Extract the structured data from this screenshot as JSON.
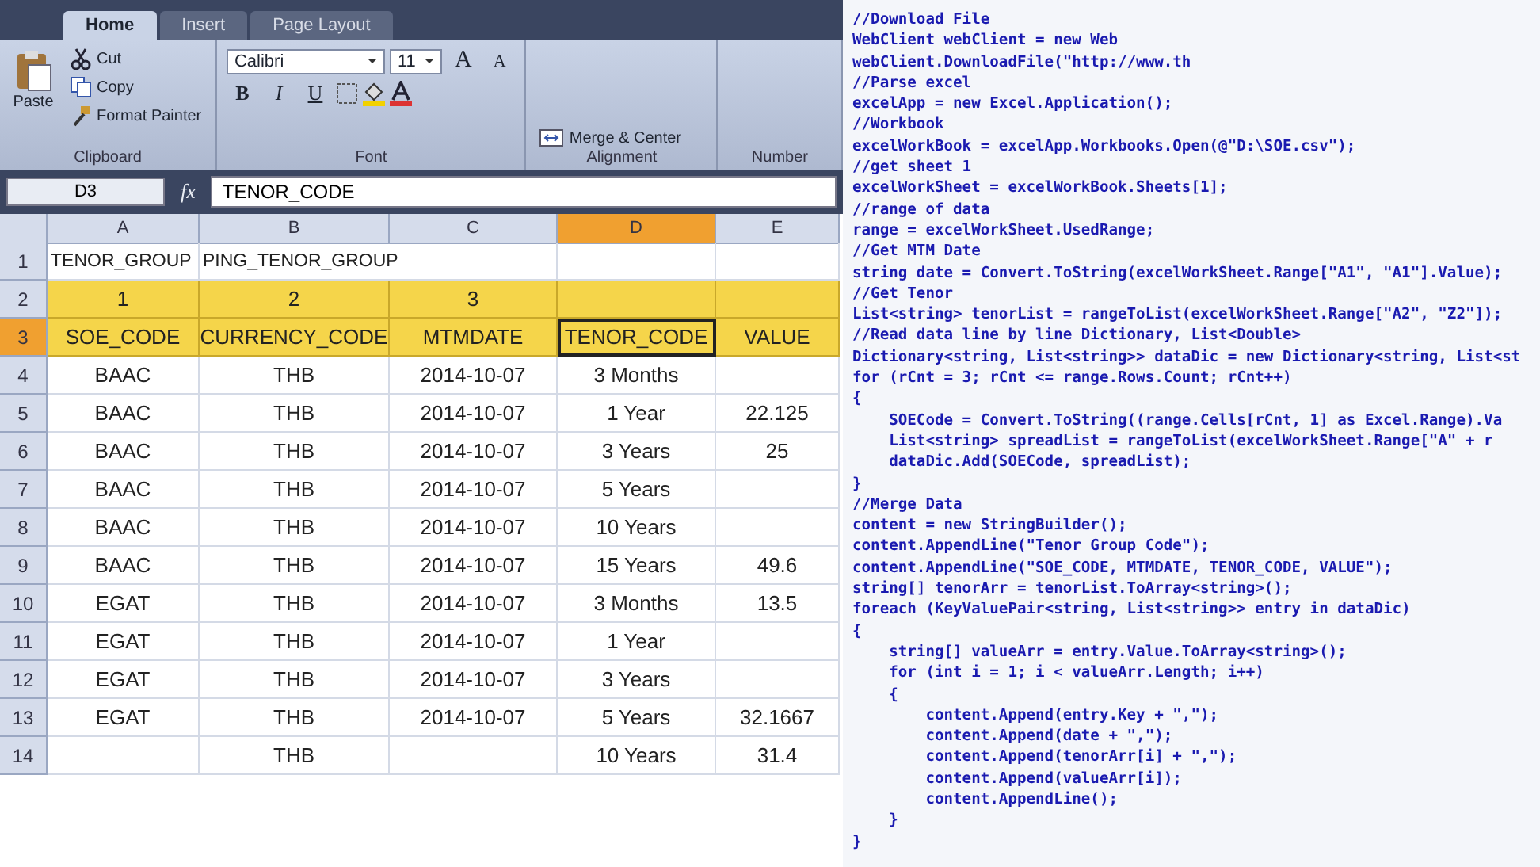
{
  "ribbon": {
    "tabs": [
      {
        "label": "Home",
        "selected": true
      },
      {
        "label": "Insert",
        "selected": false
      },
      {
        "label": "Page Layout",
        "selected": false
      }
    ],
    "clipboard": {
      "paste": "Paste",
      "cut": "Cut",
      "copy": "Copy",
      "format_painter": "Format Painter",
      "label": "Clipboard"
    },
    "font": {
      "name": "Calibri",
      "size": "11",
      "grow": "A",
      "shrink": "A",
      "bold": "B",
      "italic": "I",
      "underline": "U",
      "label": "Font"
    },
    "alignment": {
      "merge": "Merge & Center",
      "label": "Alignment"
    },
    "number": {
      "label": "Number"
    }
  },
  "formula_bar": {
    "name_box": "D3",
    "fx": "fx",
    "value": "TENOR_CODE"
  },
  "sheet": {
    "columns": [
      {
        "label": "A",
        "selected": false
      },
      {
        "label": "B",
        "selected": false
      },
      {
        "label": "C",
        "selected": false
      },
      {
        "label": "D",
        "selected": true
      },
      {
        "label": "E",
        "selected": false
      }
    ],
    "rows": [
      {
        "number": "1",
        "kind": "title",
        "selected": false,
        "cells": [
          "TENOR_GROUP",
          "PING_TENOR_GROUP"
        ]
      },
      {
        "number": "2",
        "kind": "header",
        "selected": false,
        "cells": [
          "1",
          "2",
          "3"
        ]
      },
      {
        "number": "3",
        "kind": "header",
        "selected": true,
        "cells": [
          "SOE_CODE",
          "CURRENCY_CODE",
          "MTMDATE",
          "TENOR_CODE",
          "VALUE"
        ]
      },
      {
        "number": "4",
        "kind": "data",
        "selected": false,
        "cells": [
          "BAAC",
          "THB",
          "2014-10-07",
          "3 Months"
        ]
      },
      {
        "number": "5",
        "kind": "data",
        "selected": false,
        "cells": [
          "BAAC",
          "THB",
          "2014-10-07",
          "1 Year",
          "22.125"
        ]
      },
      {
        "number": "6",
        "kind": "data",
        "selected": false,
        "cells": [
          "BAAC",
          "THB",
          "2014-10-07",
          "3 Years",
          "25"
        ]
      },
      {
        "number": "7",
        "kind": "data",
        "selected": false,
        "cells": [
          "BAAC",
          "THB",
          "2014-10-07",
          "5 Years"
        ]
      },
      {
        "number": "8",
        "kind": "data",
        "selected": false,
        "cells": [
          "BAAC",
          "THB",
          "2014-10-07",
          "10 Years"
        ]
      },
      {
        "number": "9",
        "kind": "data",
        "selected": false,
        "cells": [
          "BAAC",
          "THB",
          "2014-10-07",
          "15 Years",
          "49.6"
        ]
      },
      {
        "number": "10",
        "kind": "data",
        "selected": false,
        "cells": [
          "EGAT",
          "THB",
          "2014-10-07",
          "3 Months",
          "13.5"
        ]
      },
      {
        "number": "11",
        "kind": "data",
        "selected": false,
        "cells": [
          "EGAT",
          "THB",
          "2014-10-07",
          "1 Year"
        ]
      },
      {
        "number": "12",
        "kind": "data",
        "selected": false,
        "cells": [
          "EGAT",
          "THB",
          "2014-10-07",
          "3 Years"
        ]
      },
      {
        "number": "13",
        "kind": "data",
        "selected": false,
        "cells": [
          "EGAT",
          "THB",
          "2014-10-07",
          "5 Years",
          "32.1667"
        ]
      },
      {
        "number": "14",
        "kind": "data",
        "selected": false,
        "cells": [
          "",
          "THB",
          "",
          "10 Years",
          "31.4"
        ]
      }
    ]
  },
  "code": {
    "lines": [
      "//Download File",
      "WebClient webClient = new Web",
      "webClient.DownloadFile(\"http://www.th",
      "//Parse excel",
      "excelApp = new Excel.Application();",
      "//Workbook",
      "excelWorkBook = excelApp.Workbooks.Open(@\"D:\\SOE.csv\");",
      "//get sheet 1",
      "excelWorkSheet = excelWorkBook.Sheets[1];",
      "//range of data",
      "range = excelWorkSheet.UsedRange;",
      "//Get MTM Date",
      "string date = Convert.ToString(excelWorkSheet.Range[\"A1\", \"A1\"].Value);",
      "//Get Tenor",
      "List<string> tenorList = rangeToList(excelWorkSheet.Range[\"A2\", \"Z2\"]);",
      "//Read data line by line Dictionary, List<Double>",
      "Dictionary<string, List<string>> dataDic = new Dictionary<string, List<st",
      "for (rCnt = 3; rCnt <= range.Rows.Count; rCnt++)",
      "{",
      "    SOECode = Convert.ToString((range.Cells[rCnt, 1] as Excel.Range).Va",
      "    List<string> spreadList = rangeToList(excelWorkSheet.Range[\"A\" + r",
      "    dataDic.Add(SOECode, spreadList);",
      "}",
      "//Merge Data",
      "content = new StringBuilder();",
      "content.AppendLine(\"Tenor Group Code\");",
      "content.AppendLine(\"SOE_CODE, MTMDATE, TENOR_CODE, VALUE\");",
      "string[] tenorArr = tenorList.ToArray<string>();",
      "foreach (KeyValuePair<string, List<string>> entry in dataDic)",
      "{",
      "    string[] valueArr = entry.Value.ToArray<string>();",
      "    for (int i = 1; i < valueArr.Length; i++)",
      "    {",
      "        content.Append(entry.Key + \",\");",
      "        content.Append(date + \",\");",
      "        content.Append(tenorArr[i] + \",\");",
      "        content.Append(valueArr[i]);",
      "        content.AppendLine();",
      "    }",
      "}"
    ]
  }
}
